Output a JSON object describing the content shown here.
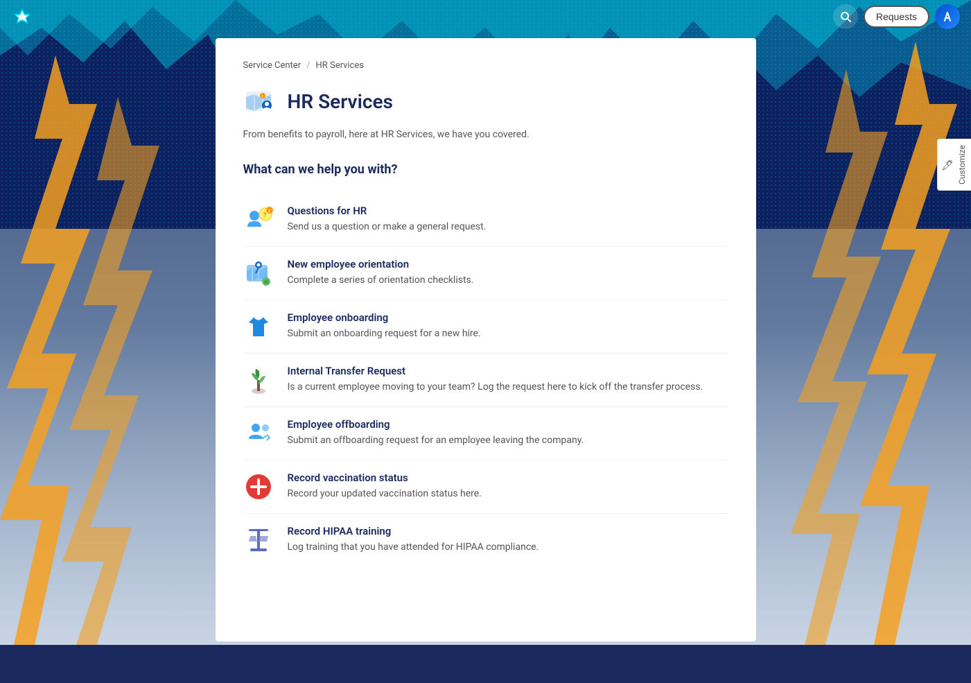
{
  "meta": {
    "title": "HR Services"
  },
  "topnav": {
    "search_label": "Search",
    "requests_label": "Requests",
    "logo_label": "A"
  },
  "breadcrumb": {
    "items": [
      {
        "label": "Service Center",
        "link": true
      },
      {
        "label": "HR Services",
        "link": false
      }
    ],
    "separator": "/"
  },
  "page": {
    "title": "HR Services",
    "description": "From benefits to payroll, here at HR Services, we have you covered.",
    "section_title": "What can we help you with?"
  },
  "services": [
    {
      "id": "questions-hr",
      "title": "Questions for HR",
      "description": "Send us a question or make a general request.",
      "icon_emoji": "🤝"
    },
    {
      "id": "new-employee-orientation",
      "title": "New employee orientation",
      "description": "Complete a series of orientation checklists.",
      "icon_emoji": "🗺️"
    },
    {
      "id": "employee-onboarding",
      "title": "Employee onboarding",
      "description": "Submit an onboarding request for a new hire.",
      "icon_emoji": "👕"
    },
    {
      "id": "internal-transfer",
      "title": "Internal Transfer Request",
      "description": "Is a current employee moving to your team? Log the request here to kick off the transfer process.",
      "icon_emoji": "🌱"
    },
    {
      "id": "employee-offboarding",
      "title": "Employee offboarding",
      "description": "Submit an offboarding request for an employee leaving the company.",
      "icon_emoji": "👥"
    },
    {
      "id": "record-vaccination",
      "title": "Record vaccination status",
      "description": "Record your updated vaccination status here.",
      "icon_emoji": "❤️"
    },
    {
      "id": "record-hipaa",
      "title": "Record HIPAA training",
      "description": "Log training that you have attended for HIPAA compliance.",
      "icon_emoji": "⚖️"
    }
  ],
  "customize": {
    "label": "Customize"
  }
}
